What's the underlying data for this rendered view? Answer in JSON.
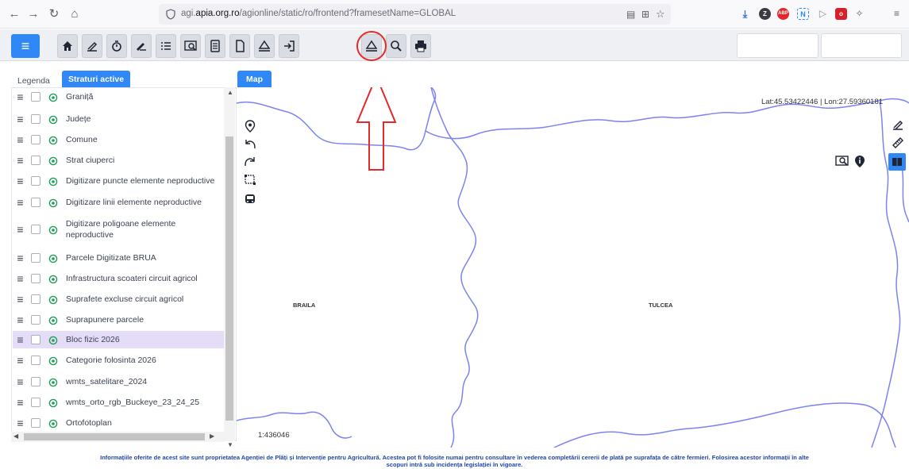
{
  "browser": {
    "url_prefix": "agi.",
    "url_domain": "apia.org.ro",
    "url_path": "/agionline/static/ro/frontend?framesetName=GLOBAL"
  },
  "toolbar": {
    "menu_icon": "hamburger-icon",
    "tools": [
      "home-icon",
      "draw-icon",
      "timer-icon",
      "edit-layer-icon",
      "list-icon",
      "map-search-icon",
      "document-icon",
      "file-icon",
      "upload-icon",
      "import-icon",
      "upload-parcel-icon",
      "zoom-icon",
      "print-icon"
    ],
    "highlighted_tool": "upload-parcel-icon"
  },
  "left_panel": {
    "tabs": [
      "Legenda",
      "Straturi active"
    ],
    "active_tab": "Straturi active",
    "layers": [
      {
        "label": "Graniță"
      },
      {
        "label": "Județe"
      },
      {
        "label": "Comune"
      },
      {
        "label": "Strat ciuperci"
      },
      {
        "label": "Digitizare puncte elemente neproductive"
      },
      {
        "label": "Digitizare linii elemente neproductive"
      },
      {
        "label": "Digitizare poligoane elemente neproductive"
      },
      {
        "label": "Parcele Digitizate BRUA"
      },
      {
        "label": "Infrastructura scoateri circuit agricol"
      },
      {
        "label": "Suprafete excluse circuit agricol"
      },
      {
        "label": "Suprapunere parcele"
      },
      {
        "label": "Bloc fizic 2026"
      },
      {
        "label": "Categorie folosinta 2026"
      },
      {
        "label": "wmts_satelitare_2024"
      },
      {
        "label": "wmts_orto_rgb_Buckeye_23_24_25"
      },
      {
        "label": "Ortofotoplan"
      }
    ],
    "selected_layer": "Bloc fizic 2026"
  },
  "map": {
    "tab_label": "Map",
    "coords": "Lat:45.53422446 | Lon:27.59360181",
    "labels": [
      "BRAILA",
      "TULCEA"
    ],
    "scale": "1:436046"
  },
  "footer": {
    "line1": "Informațiile oferite de acest site sunt proprietatea Agenției de Plăți și Intervenție pentru Agricultură. Acestea pot fi folosite numai pentru consultare în vederea completării cererii de plată pe suprafața de către fermieri. Folosirea acestor informații în alte",
    "line2": "scopuri intră sub incidența legislației în vigoare."
  },
  "colors": {
    "accent": "#2f88f5",
    "boundary": "#7b83f0",
    "annotation": "#e42a2a",
    "footer_text": "#1f46a8",
    "selected_row": "#e5ddf7"
  }
}
